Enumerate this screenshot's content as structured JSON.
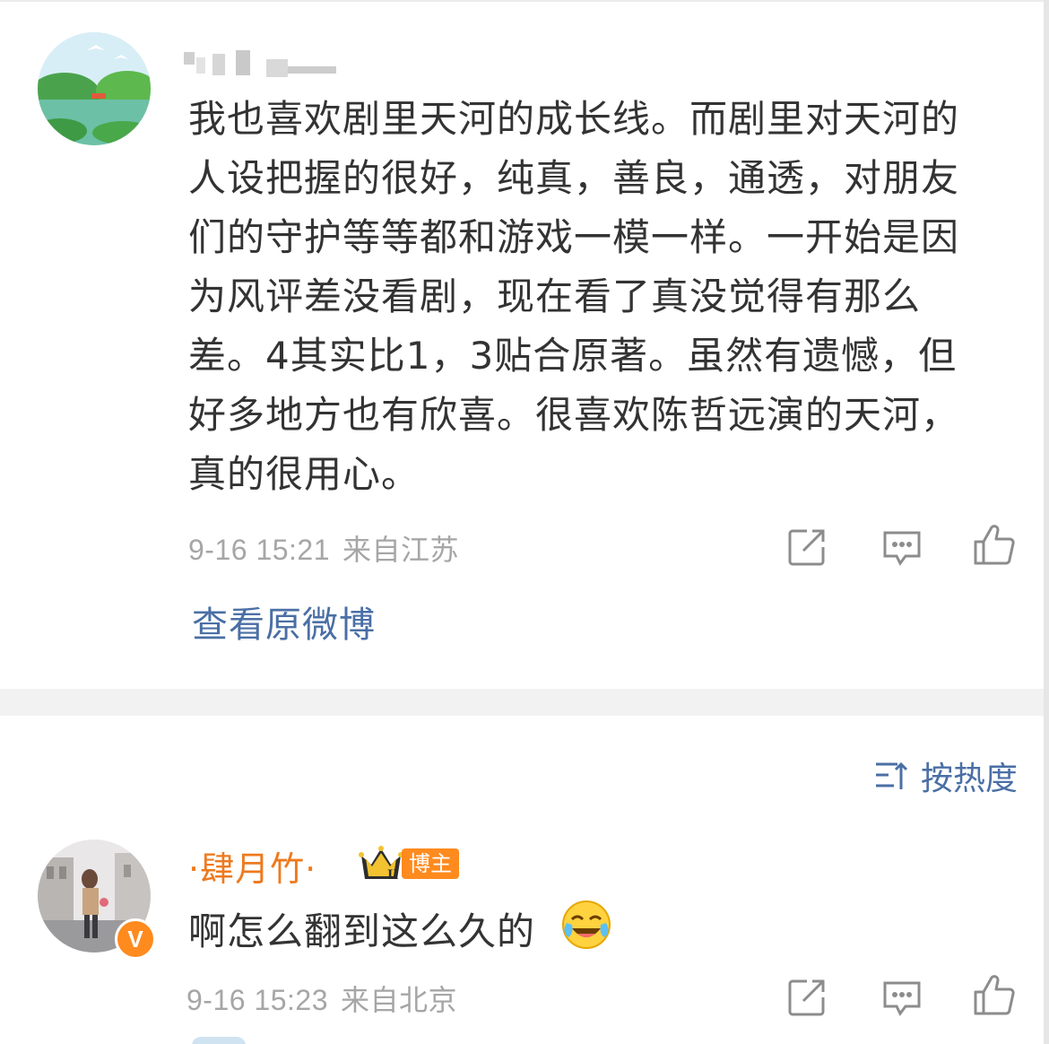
{
  "comment1": {
    "text": "我也喜欢剧里天河的成长线。而剧里对天河的人设把握的很好，纯真，善良，通透，对朋友们的守护等等都和游戏一模一样。一开始是因为风评差没看剧，现在看了真没觉得有那么差。4其实比1，3贴合原著。虽然有遗憾，但好多地方也有欣喜。很喜欢陈哲远演的天河，真的很用心。",
    "time": "9-16 15:21",
    "location": "来自江苏",
    "view_original": "查看原微博"
  },
  "sort": {
    "label": "按热度"
  },
  "comment2": {
    "username": "·肆月竹·",
    "badge": "博主",
    "crown_level": "II",
    "verified_mark": "V",
    "text": "啊怎么翻到这么久的",
    "emoji": "laughing-crying-emoji",
    "time": "9-16 15:23",
    "location": "来自北京"
  },
  "icons": {
    "share": "share-icon",
    "comment": "comment-icon",
    "like": "thumbs-up-icon",
    "sort": "sort-icon"
  },
  "colors": {
    "link": "#4a6fa5",
    "username": "#ee7a1f",
    "badge": "#ff8a1e",
    "meta": "#a6a6a6",
    "text": "#333333"
  }
}
